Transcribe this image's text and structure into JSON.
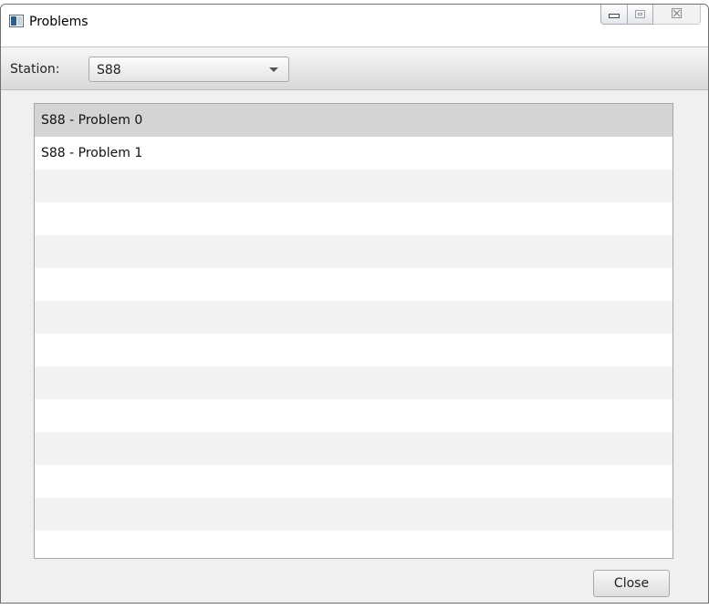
{
  "window": {
    "title": "Problems",
    "controls": {
      "minimize_icon": "minimize-icon",
      "maximize_icon": "maximize-icon",
      "close_icon": "close-icon",
      "close_glyph": "☒"
    }
  },
  "toolbar": {
    "station_label": "Station:",
    "station_value": "S88"
  },
  "problem_list": {
    "items": [
      "S88 - Problem 0",
      "S88 - Problem 1"
    ],
    "selected_index": 0,
    "visible_row_count": 13
  },
  "footer": {
    "close_label": "Close"
  },
  "colors": {
    "selected_row": "#d4d4d4",
    "alt_row": "#f2f2f2",
    "toolbar_bg": "#e6e6e6"
  }
}
